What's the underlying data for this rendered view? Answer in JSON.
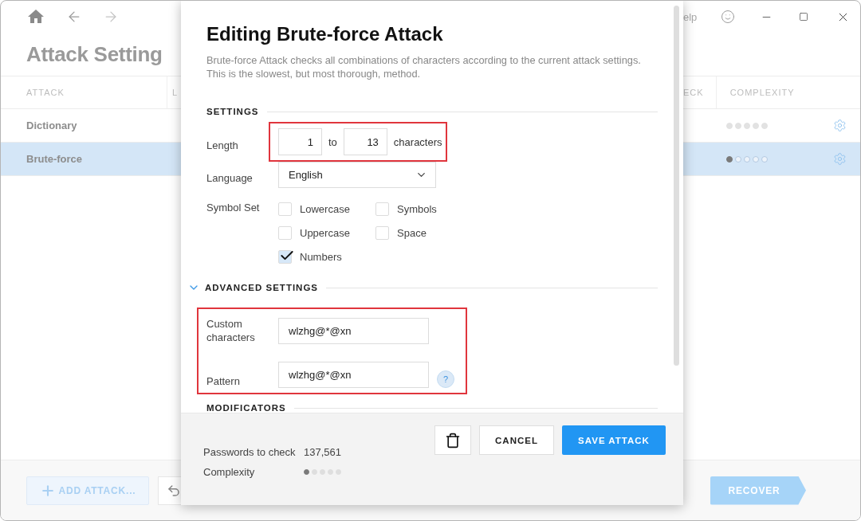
{
  "background": {
    "title": "Attack Setting",
    "help_fragment": "elp",
    "table": {
      "columns": [
        "ATTACK",
        "L",
        "ECK",
        "COMPLEXITY"
      ],
      "rows": [
        {
          "attack": "Dictionary",
          "stars": 0,
          "selected": false
        },
        {
          "attack": "Brute-force",
          "stars": 1,
          "selected": true
        }
      ]
    },
    "footer": {
      "add_button": {
        "label": "ADD ATTACK...",
        "disabled": true
      },
      "recover_button": {
        "label": "RECOVER",
        "disabled": true
      }
    }
  },
  "dialog": {
    "title": "Editing Brute-force Attack",
    "description": "Brute-force Attack checks all combinations of characters according to the current attack settings. This is the slowest, but most thorough, method.",
    "settings_heading": "SETTINGS",
    "length": {
      "label": "Length",
      "from": "1",
      "connector": "to",
      "to": "13",
      "unit": "characters",
      "highlighted": true
    },
    "language": {
      "label": "Language",
      "value": "English"
    },
    "symbol_set": {
      "label": "Symbol Set",
      "options": [
        {
          "label": "Lowercase",
          "checked": false
        },
        {
          "label": "Symbols",
          "checked": false
        },
        {
          "label": "Uppercase",
          "checked": false
        },
        {
          "label": "Space",
          "checked": false
        },
        {
          "label": "Numbers",
          "checked": true
        }
      ]
    },
    "advanced": {
      "heading": "ADVANCED SETTINGS",
      "expanded": true,
      "highlighted": true,
      "fields": [
        {
          "label": "Custom characters",
          "value": "wlzhg@*@xn"
        },
        {
          "label": "Pattern",
          "value": "wlzhg@*@xn",
          "help": "?"
        }
      ]
    },
    "modificators_heading": "MODIFICATORS",
    "summary": {
      "passwords_label": "Passwords to check",
      "passwords_value": "137,561",
      "complexity_label": "Complexity",
      "stars": 1
    },
    "buttons": {
      "cancel": "CANCEL",
      "save": "SAVE ATTACK"
    }
  }
}
